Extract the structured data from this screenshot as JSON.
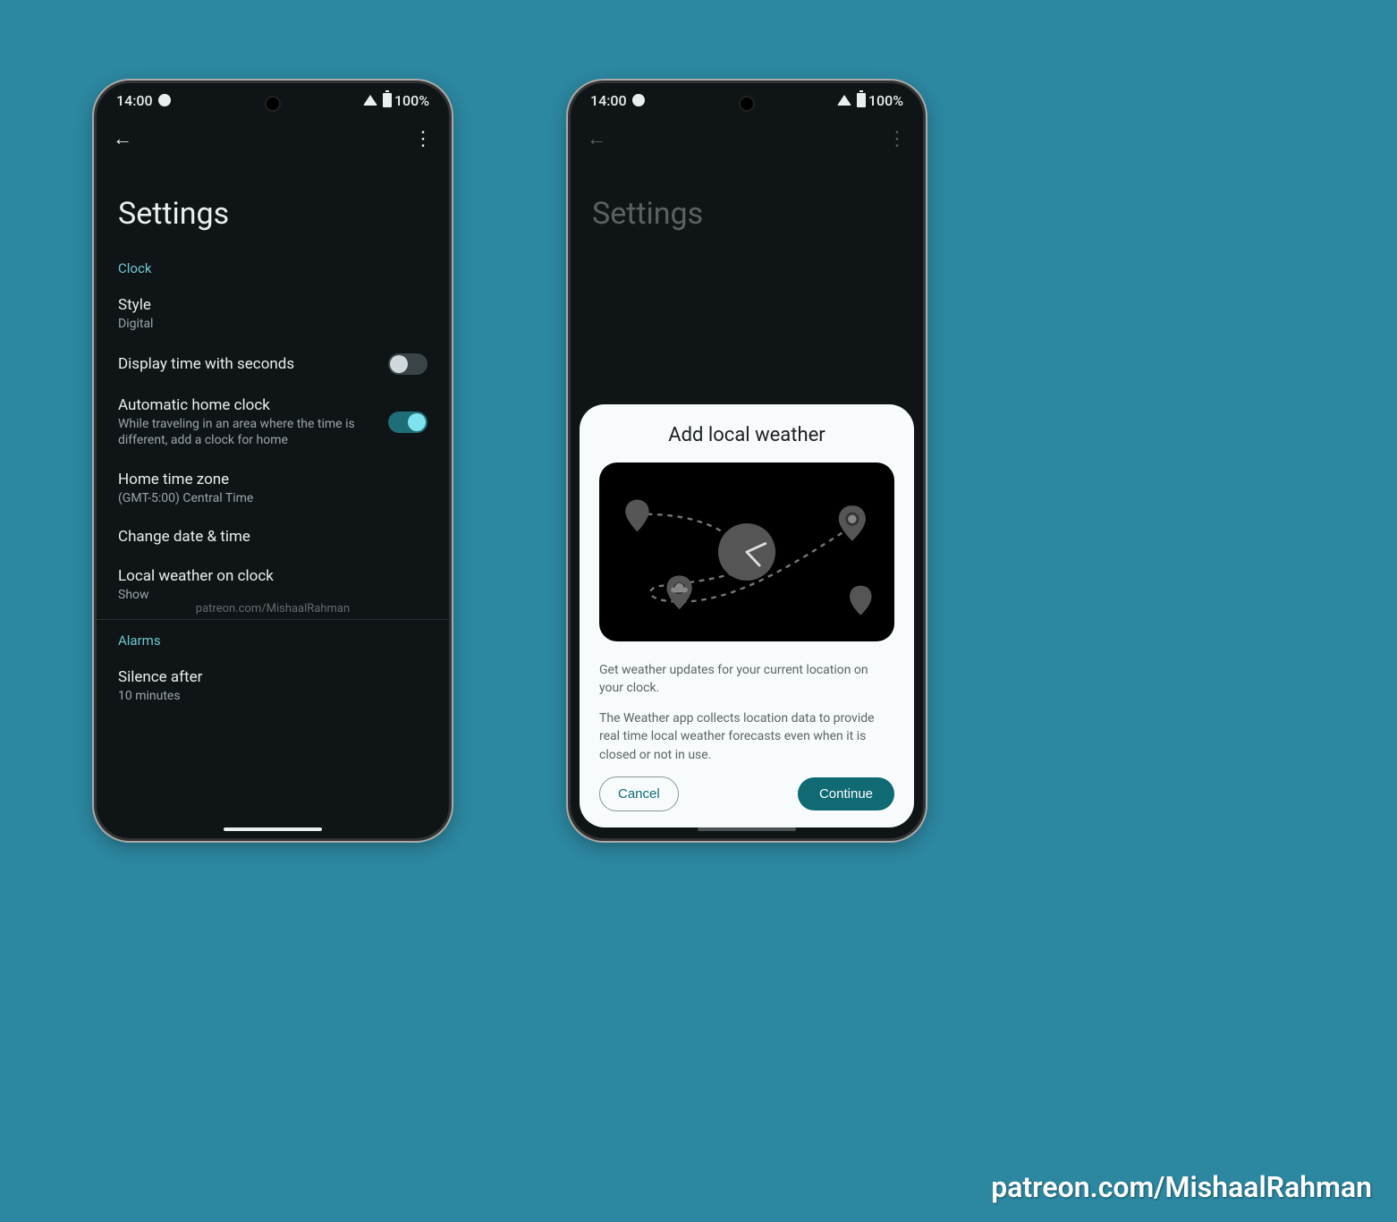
{
  "status": {
    "time": "14:00",
    "battery": "100%"
  },
  "left": {
    "title": "Settings",
    "section1": "Clock",
    "style": {
      "label": "Style",
      "value": "Digital"
    },
    "seconds": {
      "label": "Display time with seconds"
    },
    "autohome": {
      "label": "Automatic home clock",
      "desc": "While traveling in an area where the time is different, add a clock for home"
    },
    "tz": {
      "label": "Home time zone",
      "value": "(GMT-5:00) Central Time"
    },
    "changedt": {
      "label": "Change date & time"
    },
    "weather": {
      "label": "Local weather on clock",
      "value": "Show"
    },
    "watermark": "patreon.com/MishaalRahman",
    "section2": "Alarms",
    "silence": {
      "label": "Silence after",
      "value": "10 minutes"
    }
  },
  "right": {
    "title_bg": "Settings",
    "sheet": {
      "title": "Add local weather",
      "p1": "Get weather updates for your current location on your clock.",
      "p2": "The Weather app collects location data to provide real time local weather forecasts even when it is closed or not in use.",
      "cancel": "Cancel",
      "continue": "Continue"
    }
  },
  "credit": "patreon.com/MishaalRahman"
}
